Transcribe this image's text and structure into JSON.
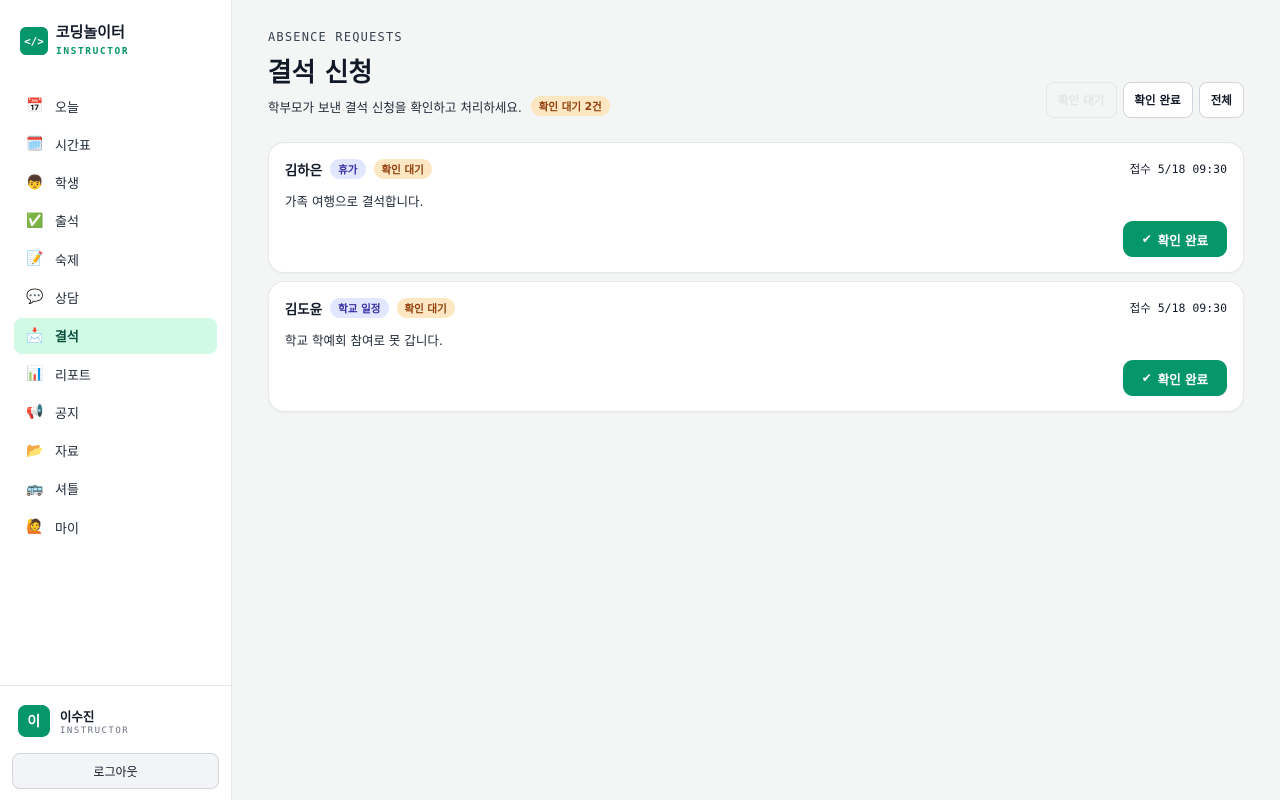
{
  "brand": {
    "logo_glyph": "</>",
    "name": "코딩놀이터",
    "role": "INSTRUCTOR",
    "accent": "#059669"
  },
  "nav": {
    "items": [
      {
        "icon": "📅",
        "icon_name": "calendar-icon",
        "label": "오늘"
      },
      {
        "icon": "🗓️",
        "icon_name": "spiral-calendar-icon",
        "label": "시간표"
      },
      {
        "icon": "👦",
        "icon_name": "boy-icon",
        "label": "학생"
      },
      {
        "icon": "✅",
        "icon_name": "check-mark-icon",
        "label": "출석"
      },
      {
        "icon": "📝",
        "icon_name": "memo-icon",
        "label": "숙제"
      },
      {
        "icon": "💬",
        "icon_name": "speech-bubble-icon",
        "label": "상담"
      },
      {
        "icon": "📩",
        "icon_name": "envelope-icon",
        "label": "결석",
        "active": true
      },
      {
        "icon": "📊",
        "icon_name": "bar-chart-icon",
        "label": "리포트"
      },
      {
        "icon": "📢",
        "icon_name": "megaphone-icon",
        "label": "공지"
      },
      {
        "icon": "📂",
        "icon_name": "folder-icon",
        "label": "자료"
      },
      {
        "icon": "🚌",
        "icon_name": "bus-icon",
        "label": "셔틀"
      },
      {
        "icon": "🙋",
        "icon_name": "person-raising-hand-icon",
        "label": "마이"
      }
    ]
  },
  "user": {
    "initial": "이",
    "name": "이수진",
    "role": "INSTRUCTOR",
    "logout_label": "로그아웃"
  },
  "header": {
    "eyebrow": "ABSENCE REQUESTS",
    "title": "결석 신청",
    "subtitle": "학부모가 보낸 결석 신청을 확인하고 처리하세요.",
    "pending_badge": "확인 대기 2건"
  },
  "filters": [
    {
      "label": "확인 대기",
      "muted": true
    },
    {
      "label": "확인 완료"
    },
    {
      "label": "전체"
    }
  ],
  "requests": [
    {
      "student": "김하은",
      "type": "휴가",
      "status": "확인 대기",
      "received": "접수 5/18 09:30",
      "reason": "가족 여행으로 결석합니다.",
      "confirm_label": "확인 완료"
    },
    {
      "student": "김도윤",
      "type": "학교 일정",
      "status": "확인 대기",
      "received": "접수 5/18 09:30",
      "reason": "학교 학예회 참여로 못 갑니다.",
      "confirm_label": "확인 완료"
    }
  ],
  "colors": {
    "accent": "#059669",
    "active_nav_bg": "#d1fae5",
    "pending_bg": "#fde7c3",
    "type_bg": "#e0e7ff"
  }
}
